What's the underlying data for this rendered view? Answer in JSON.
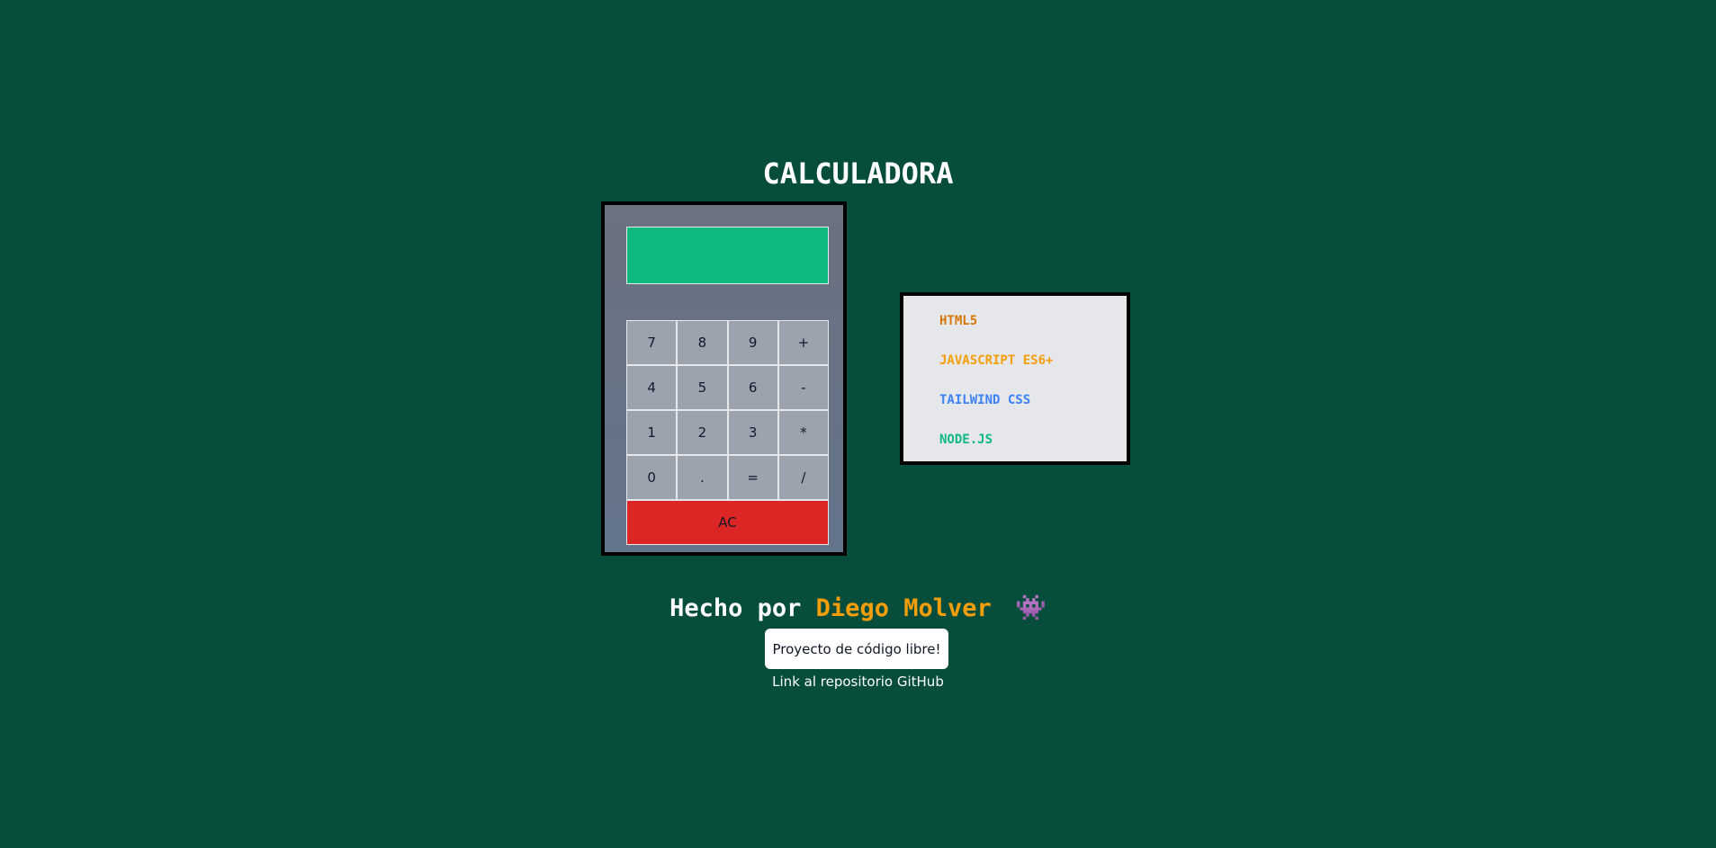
{
  "header": {
    "title": "CALCULADORA"
  },
  "calculator": {
    "display_value": "",
    "keys": [
      [
        "7",
        "8",
        "9",
        "+"
      ],
      [
        "4",
        "5",
        "6",
        "-"
      ],
      [
        "1",
        "2",
        "3",
        "*"
      ],
      [
        "0",
        ".",
        "=",
        "/"
      ]
    ],
    "clear_label": "AC"
  },
  "tech_stack": {
    "items": [
      {
        "label": "HTML5",
        "color": "#d97706"
      },
      {
        "label": "JAVASCRIPT ES6+",
        "color": "#f59e0b"
      },
      {
        "label": "TAILWIND CSS",
        "color": "#3b82f6"
      },
      {
        "label": "NODE.JS",
        "color": "#10b981"
      }
    ]
  },
  "footer": {
    "made_by_prefix": "Hecho por",
    "author": "Diego Molver",
    "author_icon": "alien-monster-icon",
    "open_source_label": "Proyecto de código libre!",
    "repo_link_label": "Link al repositorio GitHub"
  },
  "colors": {
    "background": "#064e3b",
    "display": "#10b981",
    "clear_button": "#dc2626",
    "author": "#f59e0b"
  }
}
